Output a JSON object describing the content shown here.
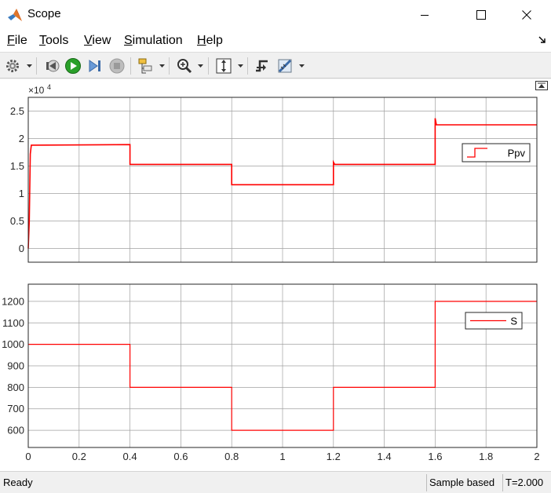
{
  "window": {
    "title": "Scope",
    "minimize_glyph": "minimize-icon",
    "maximize_glyph": "maximize-icon",
    "close_glyph": "close-icon"
  },
  "menu": {
    "items": [
      {
        "label": "File",
        "u": "F",
        "rest": "ile"
      },
      {
        "label": "Tools",
        "u": "T",
        "rest": "ools"
      },
      {
        "label": "View",
        "u": "V",
        "rest": "iew"
      },
      {
        "label": "Simulation",
        "u": "S",
        "rest": "imulation"
      },
      {
        "label": "Help",
        "u": "H",
        "rest": "elp"
      }
    ]
  },
  "toolbar": {
    "icons": [
      "gear-icon",
      "step-back-icon",
      "run-icon",
      "step-forward-icon",
      "stop-icon",
      "signal-selector-icon",
      "zoom-icon",
      "autoscale-icon",
      "triggers-icon",
      "measurements-icon"
    ]
  },
  "colors": {
    "signal": "#ff0000",
    "grid": "#a0a0a0",
    "run_green": "#2aa02a"
  },
  "chart_data": [
    {
      "type": "line",
      "exponent_label": "×10",
      "exponent": "4",
      "xlim": [
        0,
        2
      ],
      "ylim": [
        -0.25,
        2.75
      ],
      "yticks": [
        0,
        0.5,
        1,
        1.5,
        2,
        2.5
      ],
      "ytick_labels": [
        "0",
        "0.5",
        "1",
        "1.5",
        "2",
        "2.5"
      ],
      "xticks": [
        0,
        0.2,
        0.4,
        0.6,
        0.8,
        1,
        1.2,
        1.4,
        1.6,
        1.8,
        2
      ],
      "grid": true,
      "legend": "right",
      "series": [
        {
          "name": "Ppv",
          "x": [
            0,
            0.004,
            0.008,
            0.012,
            0.4,
            0.4,
            0.8,
            0.8,
            1.2,
            1.2,
            1.205,
            1.6,
            1.6,
            1.605,
            2.0
          ],
          "y": [
            0,
            0.5,
            1.72,
            1.88,
            1.89,
            1.53,
            1.53,
            1.16,
            1.16,
            1.57,
            1.53,
            1.53,
            2.37,
            2.25,
            2.25
          ]
        }
      ]
    },
    {
      "type": "line",
      "xlim": [
        0,
        2
      ],
      "ylim": [
        520,
        1280
      ],
      "yticks": [
        600,
        700,
        800,
        900,
        1000,
        1100,
        1200
      ],
      "ytick_labels": [
        "600",
        "700",
        "800",
        "900",
        "1000",
        "1100",
        "1200"
      ],
      "xticks": [
        0,
        0.2,
        0.4,
        0.6,
        0.8,
        1,
        1.2,
        1.4,
        1.6,
        1.8,
        2
      ],
      "xtick_labels": [
        "0",
        "0.2",
        "0.4",
        "0.6",
        "0.8",
        "1",
        "1.2",
        "1.4",
        "1.6",
        "1.8",
        "2"
      ],
      "grid": true,
      "legend": "right",
      "series": [
        {
          "name": "S",
          "x": [
            0,
            0.4,
            0.4,
            0.8,
            0.8,
            1.2,
            1.2,
            1.6,
            1.6,
            2.0
          ],
          "y": [
            1000,
            1000,
            800,
            800,
            600,
            600,
            800,
            800,
            1200,
            1200
          ]
        }
      ]
    }
  ],
  "status": {
    "ready": "Ready",
    "sample_based": "Sample based",
    "time": "T=2.000"
  }
}
